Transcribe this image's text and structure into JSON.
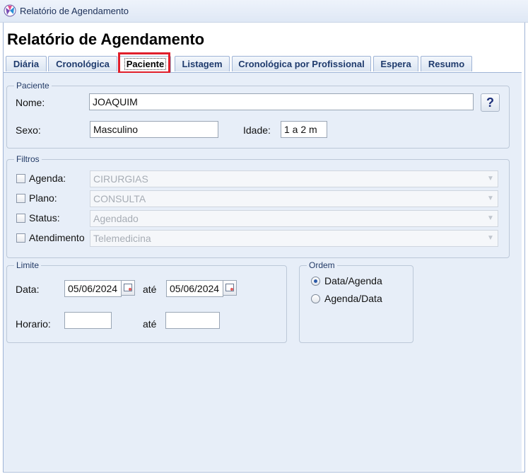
{
  "window": {
    "title": "Relatório de Agendamento"
  },
  "header": {
    "title": "Relatório de Agendamento"
  },
  "tabs": [
    {
      "label": "Diária"
    },
    {
      "label": "Cronológica"
    },
    {
      "label": "Paciente",
      "active": true
    },
    {
      "label": "Listagem"
    },
    {
      "label": "Cronológica por Profissional"
    },
    {
      "label": "Espera"
    },
    {
      "label": "Resumo"
    }
  ],
  "paciente": {
    "legend": "Paciente",
    "nome_label": "Nome:",
    "nome_value": "JOAQUIM",
    "help_label": "?",
    "sexo_label": "Sexo:",
    "sexo_value": "Masculino",
    "idade_label": "Idade:",
    "idade_value": "1 a 2 m"
  },
  "filtros": {
    "legend": "Filtros",
    "items": [
      {
        "label": "Agenda:",
        "value": "CIRURGIAS",
        "checked": false
      },
      {
        "label": "Plano:",
        "value": "CONSULTA",
        "checked": false
      },
      {
        "label": "Status:",
        "value": "Agendado",
        "checked": false
      },
      {
        "label": "Atendimento",
        "value": "Telemedicina",
        "checked": false
      }
    ]
  },
  "limite": {
    "legend": "Limite",
    "data_label": "Data:",
    "data_from": "05/06/2024",
    "ate_label": "até",
    "data_to": "05/06/2024",
    "horario_label": "Horario:",
    "horario_from": "",
    "horario_to": ""
  },
  "ordem": {
    "legend": "Ordem",
    "options": [
      {
        "label": "Data/Agenda",
        "selected": true
      },
      {
        "label": "Agenda/Data",
        "selected": false
      }
    ]
  },
  "colors": {
    "highlight": "#e01e2a",
    "panel_bg": "#e7eef8",
    "tab_text": "#1f3b6d"
  }
}
